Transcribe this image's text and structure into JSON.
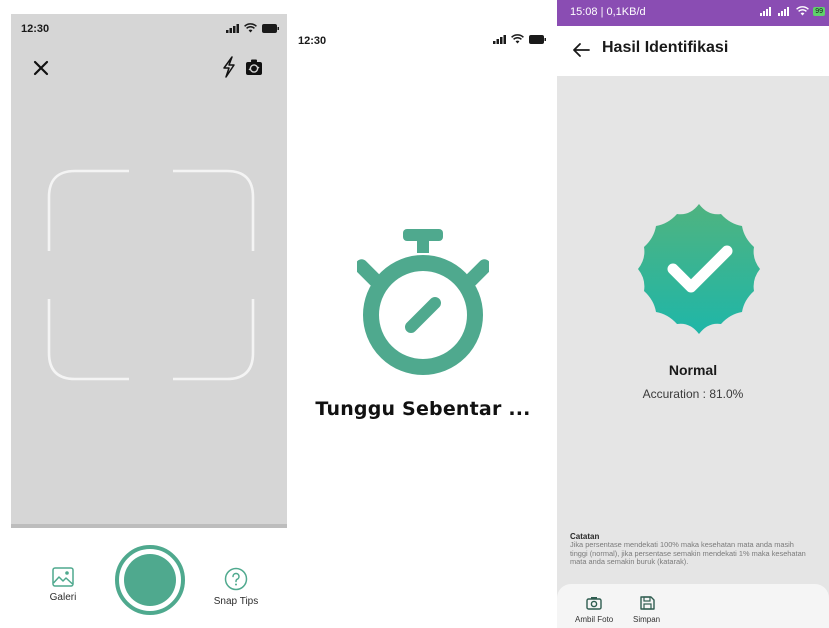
{
  "colors": {
    "accent": "#4fa98e",
    "statusbar": "#8a4db3",
    "badge_top": "#4fb380",
    "badge_bottom": "#1fb6a8"
  },
  "camera": {
    "status": {
      "time": "12:30"
    },
    "icons": {
      "close": "close-icon",
      "flash": "flash-icon",
      "flip": "flip-camera-icon",
      "gallery": "image-icon",
      "tips": "question-icon"
    },
    "bottom_nav": {
      "gallery_label": "Galeri",
      "tips_label": "Snap Tips"
    }
  },
  "loading": {
    "status": {
      "time": "12:30"
    },
    "message": "Tunggu Sebentar ..."
  },
  "result": {
    "status": {
      "text": "15:08 | 0,1KB/d",
      "battery": "99"
    },
    "title": "Hasil Identifikasi",
    "label": "Normal",
    "accuracy_text": "Accuration : 81.0%",
    "note": {
      "title": "Catatan",
      "line1": "Jika persentase mendekati 100% maka kesehatan mata anda masih",
      "line2": "tinggi (normal), jika persentase semakin mendekati 1% maka kesehatan",
      "line3": "mata anda semakin buruk (katarak)."
    },
    "bottom_nav": {
      "camera_label": "Ambil Foto",
      "save_label": "Simpan"
    }
  }
}
